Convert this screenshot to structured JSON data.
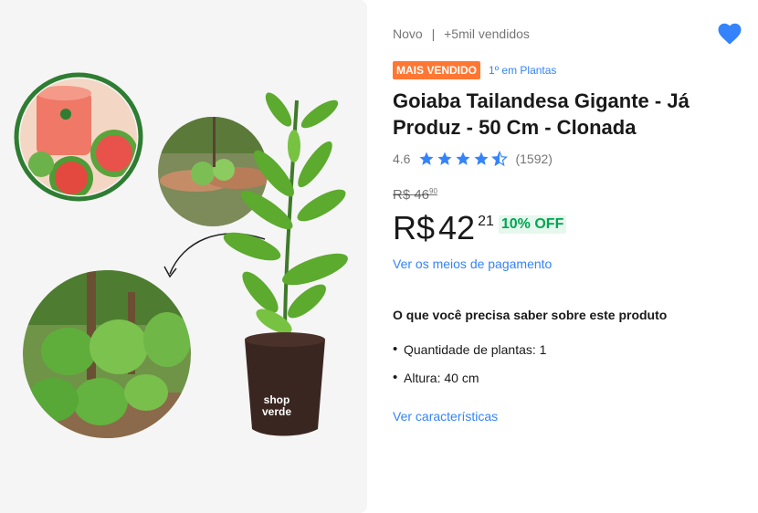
{
  "header": {
    "condition": "Novo",
    "separator": "|",
    "sold": "+5mil vendidos"
  },
  "badges": {
    "best_seller": "MAIS VENDIDO",
    "ranking": "1º em Plantas"
  },
  "product": {
    "title": "Goiaba Tailandesa Gigante - Já Produz - 50 Cm - Clonada",
    "image_brand": "shop verde"
  },
  "rating": {
    "value": "4.6",
    "stars": 4.6,
    "count": "(1592)"
  },
  "price": {
    "original_label": "R$ 46",
    "original_cents": "90",
    "currency": "R$",
    "integer": "42",
    "cents": "21",
    "discount": "10% OFF"
  },
  "links": {
    "payment": "Ver os meios de pagamento",
    "characteristics": "Ver características"
  },
  "highlights": {
    "heading": "O que você precisa saber sobre este produto",
    "items": [
      "Quantidade de plantas: 1",
      "Altura: 40 cm"
    ]
  },
  "icons": {
    "favorite": "heart-icon",
    "rating": "star-icon"
  },
  "colors": {
    "accent": "#3483fa",
    "badge": "#ff7733",
    "discount": "#00a650",
    "star": "#3483fa"
  }
}
